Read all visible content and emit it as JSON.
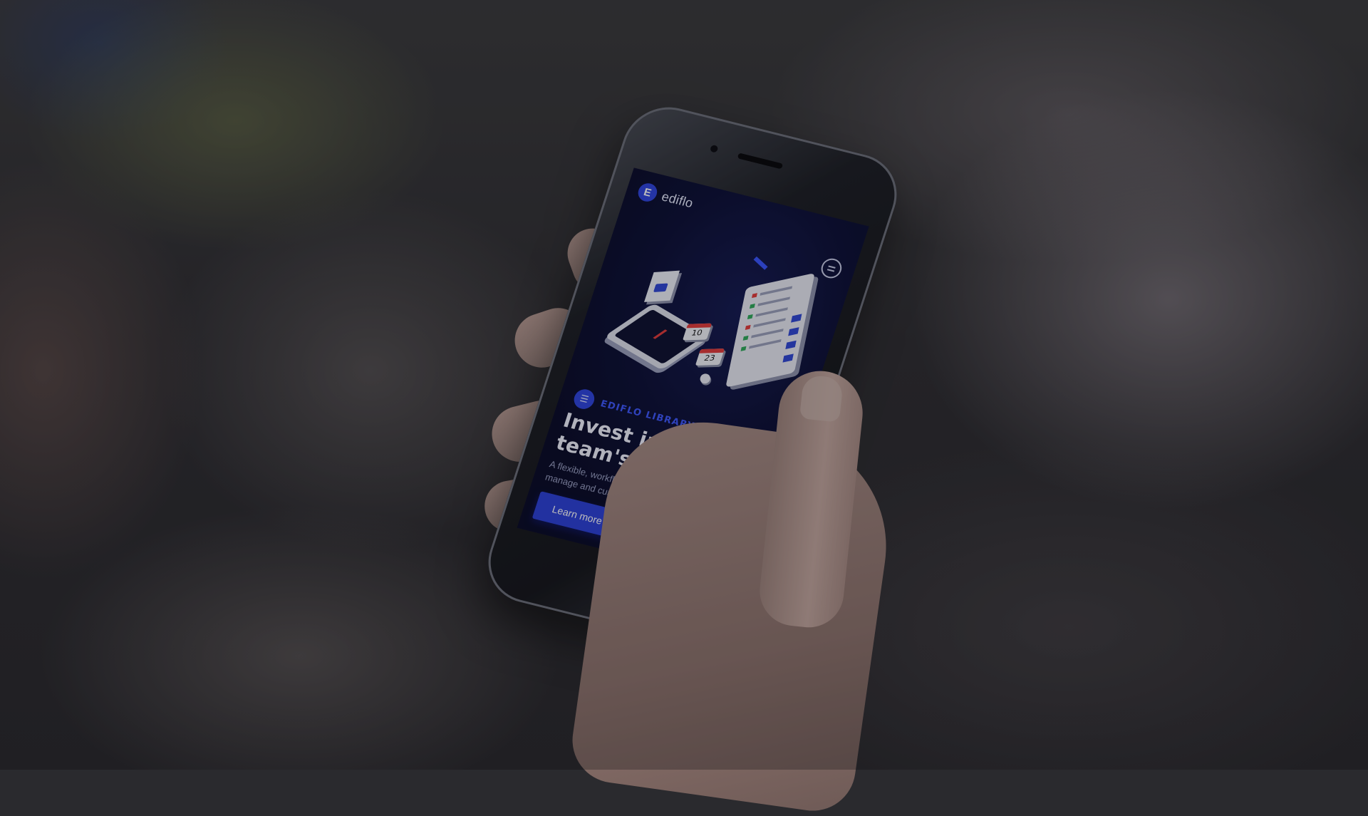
{
  "app": {
    "brand": "ediflo",
    "logo_glyph": "E",
    "menu_icon": "hamburger-icon"
  },
  "hero": {
    "eyebrow": "EDIFLO LIBRARY",
    "eyebrow_icon": "library-icon",
    "headline": "Invest in your team's efficiency",
    "description": "A flexible, workflow based system to manage and curate your content.",
    "cta_label": "Learn more"
  },
  "illustration": {
    "calendar_1": "10",
    "calendar_2": "23"
  },
  "colors": {
    "screen_bg": "#0c0f36",
    "accent": "#2f45e0",
    "eyebrow": "#3e58ff",
    "headline": "#f1f3ff"
  }
}
